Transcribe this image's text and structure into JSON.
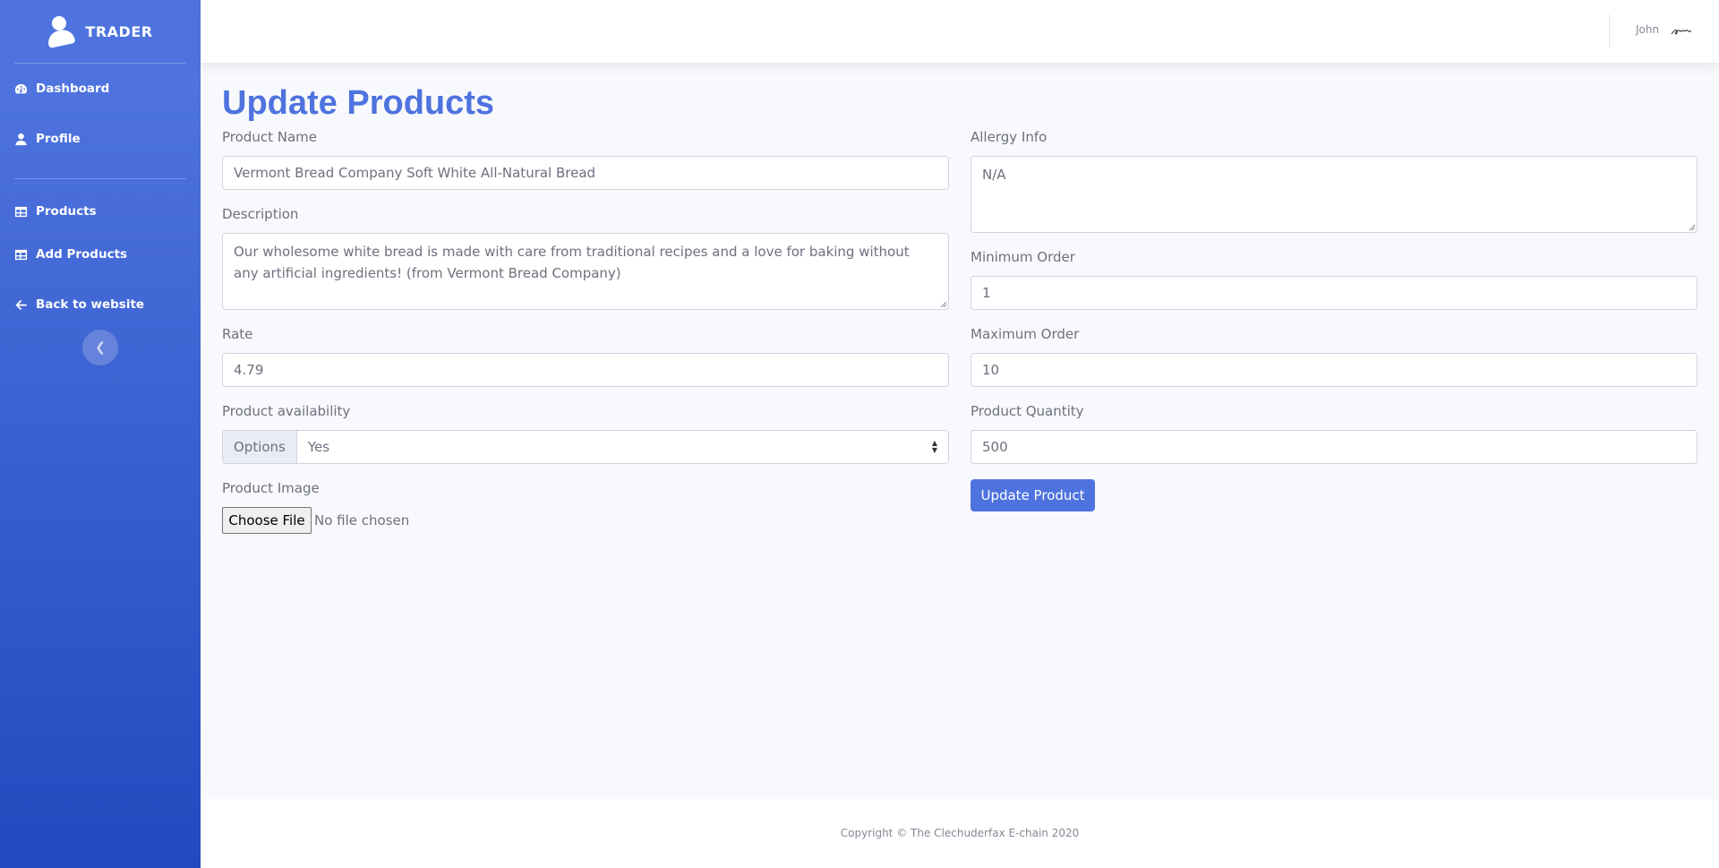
{
  "sidebar": {
    "brand": "TRADER",
    "items": [
      {
        "label": "Dashboard",
        "icon": "tachometer-icon"
      },
      {
        "label": "Profile",
        "icon": "user-icon"
      },
      {
        "label": "Products",
        "icon": "table-icon"
      },
      {
        "label": "Add Products",
        "icon": "table-icon"
      },
      {
        "label": "Back to website",
        "icon": "arrow-left-icon"
      }
    ],
    "toggle_icon": "chevron-left-icon"
  },
  "topbar": {
    "user_name": "John"
  },
  "page": {
    "title": "Update Products"
  },
  "form": {
    "product_name": {
      "label": "Product Name",
      "value": "Vermont Bread Company Soft White All-Natural Bread"
    },
    "description": {
      "label": "Description",
      "value": "Our wholesome white bread is made with care from traditional recipes and a love for baking without any artificial ingredients! (from Vermont Bread Company)"
    },
    "rate": {
      "label": "Rate",
      "value": "4.79"
    },
    "availability": {
      "label": "Product availability",
      "prepend": "Options",
      "selected": "Yes"
    },
    "image": {
      "label": "Product Image",
      "button": "Choose File",
      "status": "No file chosen"
    },
    "allergy": {
      "label": "Allergy Info",
      "value": "N/A"
    },
    "min_order": {
      "label": "Minimum Order",
      "value": "1"
    },
    "max_order": {
      "label": "Maximum Order",
      "value": "10"
    },
    "quantity": {
      "label": "Product Quantity",
      "value": "500"
    },
    "submit_label": "Update Product"
  },
  "footer": {
    "copyright": "Copyright © The Clechuderfax E-chain 2020"
  },
  "colors": {
    "primary": "#4e73df",
    "sidebar_gradient_end": "#224abe",
    "background": "#f8f9fc"
  }
}
